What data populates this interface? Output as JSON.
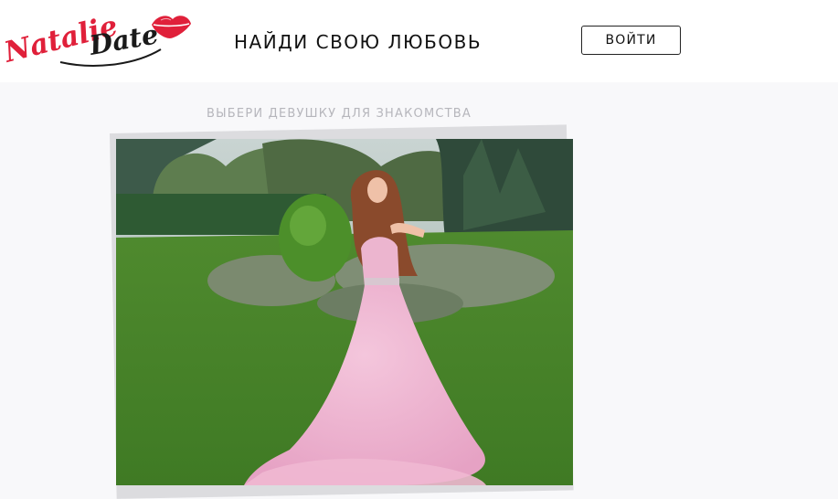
{
  "header": {
    "logo_text": "NatalieDate",
    "tagline": "НАЙДИ СВОЮ ЛЮБОВЬ",
    "login_label": "ВОЙТИ"
  },
  "main": {
    "section_title": "ВЫБЕРИ ДЕВУШКУ ДЛЯ ЗНАКОМСТВА"
  },
  "colors": {
    "logo_red": "#e0203a",
    "logo_dark": "#1a1a1a",
    "page_bg": "#f8f8fa",
    "muted_text": "#b6b6bc"
  },
  "icons": [
    "lips-icon"
  ]
}
